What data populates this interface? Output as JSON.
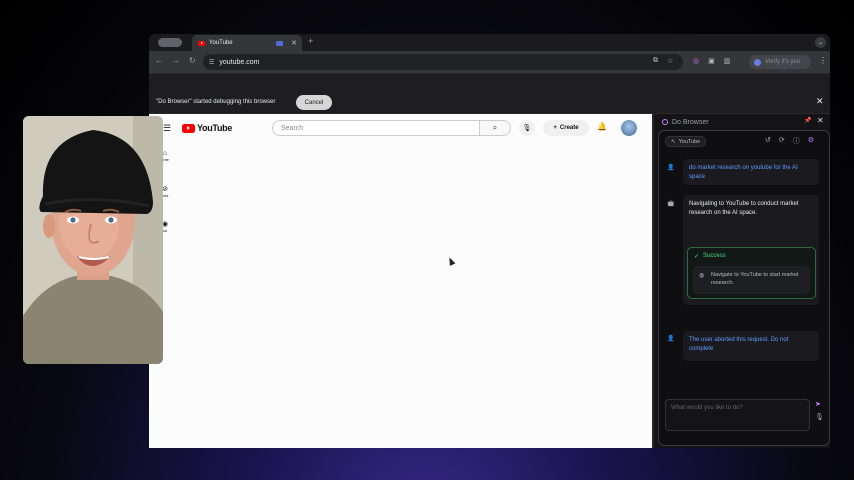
{
  "browser": {
    "tab": {
      "title": "YouTube"
    },
    "newtab_icon": "plus-icon",
    "address": "youtube.com",
    "verify_label": "Verify it's you",
    "infobar": {
      "message": "\"Do Browser\" started debugging this browser",
      "cancel_label": "Cancel"
    }
  },
  "youtube": {
    "logo_text": "YouTube",
    "search_placeholder": "Search",
    "create_label": "Create",
    "sidebar": [
      {
        "label": "ome",
        "icon": "home-icon"
      },
      {
        "label": "orts",
        "icon": "shorts-icon"
      },
      {
        "label": "ou",
        "icon": "you-icon"
      }
    ]
  },
  "panel": {
    "title": "Do Browser",
    "chip_label": "YouTube",
    "messages": [
      {
        "role": "user",
        "text": "do market research on youtube for the AI space"
      },
      {
        "role": "bot",
        "text": "Navigating to YouTube to conduct market research on the AI space."
      },
      {
        "role": "user",
        "text": "The user aborted this request. Do not complete"
      }
    ],
    "success_label": "Success",
    "success_step": "Navigate to YouTube to start market research.",
    "input_placeholder": "What would you like to do?"
  },
  "colors": {
    "accent": "#c77dff",
    "user_text": "#5e9bff",
    "success": "#4ade80",
    "youtube_red": "#ff0000"
  }
}
